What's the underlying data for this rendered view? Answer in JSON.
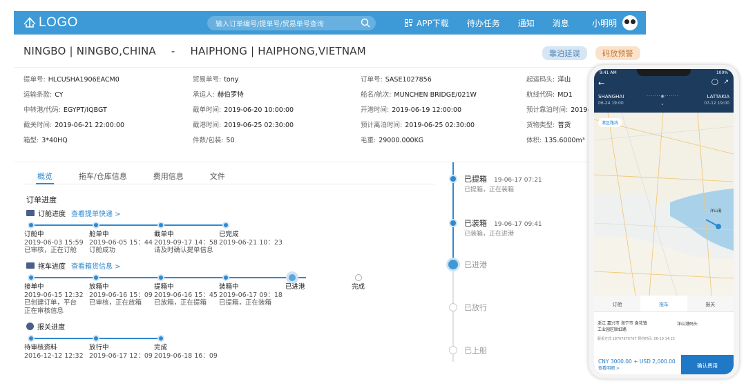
{
  "header": {
    "logo": "LOGO",
    "search_placeholder": "输入订单编号/提单号/贸易单号查询",
    "nav": [
      "APP下载",
      "待办任务",
      "通知",
      "消息"
    ],
    "user": "小明明"
  },
  "route": {
    "origin": "NINGBO | NINGBO,CHINA",
    "separator": "-",
    "destination": "HAIPHONG | HAIPHONG,VIETNAM",
    "badges": [
      "靠泊延误",
      "码放预警"
    ]
  },
  "info": {
    "c1": [
      [
        "提单号:",
        "HLCUSHA1906EACM0"
      ],
      [
        "运输条款:",
        "CY"
      ],
      [
        "中转港/代码:",
        "EGYPT/IQBGT"
      ],
      [
        "截关时间:",
        "2019-06-21 22:00:00"
      ],
      [
        "箱型:",
        "3*40HQ"
      ]
    ],
    "c2": [
      [
        "贸易单号:",
        "tony"
      ],
      [
        "承运人:",
        "赫伯罗特"
      ],
      [
        "截单时间:",
        "2019-06-20 10:00:00"
      ],
      [
        "截港时间:",
        "2019-06-25 02:30:00"
      ],
      [
        "件数/包装:",
        "50"
      ]
    ],
    "c3": [
      [
        "订单号:",
        "SASE1027856"
      ],
      [
        "船名/航次:",
        "MUNCHEN BRIDGE/021W"
      ],
      [
        "开港时间:",
        "2019-06-19 12:00:00"
      ],
      [
        "预计离泊时间:",
        "2019-06-25 02:30:00"
      ],
      [
        "毛重:",
        "29000.000KG"
      ]
    ],
    "c4": [
      [
        "起运码头:",
        "洋山"
      ],
      [
        "航线代码:",
        "MD1"
      ],
      [
        "预计靠泊时间:",
        "2019-"
      ],
      [
        "货物类型:",
        "普货"
      ],
      [
        "体积:",
        "135.6000m³"
      ]
    ]
  },
  "tabs": [
    "概览",
    "拖车/仓库信息",
    "费用信息",
    "文件"
  ],
  "progress": {
    "title": "订单进度",
    "booking": {
      "label": "订舱进度",
      "link": "查看提单快递 >",
      "steps": [
        {
          "t": "订舱中",
          "d": "2019-06-03 15:59",
          "s": "已审核，正在订舱",
          "s2": ""
        },
        {
          "t": "舱单中",
          "d": "2019-06-05 15：44",
          "s": "订舱成功",
          "s2": ""
        },
        {
          "t": "截单中",
          "d": "2019-09-17 14：58",
          "s": "请及时确认提单信息",
          "s2": ""
        },
        {
          "t": "已完成",
          "d": "2019-06-21 10：23",
          "s": "",
          "s2": ""
        }
      ]
    },
    "truck": {
      "label": "拖车进度",
      "link": "查看箱货信息 >",
      "steps": [
        {
          "t": "接单中",
          "d": "2019-06-15 12:32",
          "s": "已创建订单，平台",
          "s2": "正在审核信息"
        },
        {
          "t": "放箱中",
          "d": "2019-06-16 15：09",
          "s": "已审核，正在放箱",
          "s2": ""
        },
        {
          "t": "提箱中",
          "d": "2019-06-16 15：45",
          "s": "已放箱，正在提箱",
          "s2": ""
        },
        {
          "t": "装箱中",
          "d": "2019-06-17 09：18",
          "s": "已提箱，正在装箱",
          "s2": ""
        },
        {
          "t": "已进港",
          "d": "",
          "s": "",
          "s2": ""
        },
        {
          "t": "完成",
          "d": "",
          "s": "",
          "s2": ""
        }
      ]
    },
    "customs": {
      "label": "报关进度",
      "steps": [
        {
          "t": "待审核资料",
          "d": "2016-12-12 12:32",
          "s": "",
          "s2": ""
        },
        {
          "t": "放行中",
          "d": "2019-06-17 12：09",
          "s": "",
          "s2": ""
        },
        {
          "t": "完成",
          "d": "2019-06-18 16：09",
          "s": "",
          "s2": ""
        }
      ]
    }
  },
  "timeline": [
    {
      "t": "已提箱",
      "time": "19-06-17 07:21",
      "s": "已提箱，正在装箱"
    },
    {
      "t": "已装箱",
      "time": "19-06-17 09:41",
      "s": "已装箱，正在进港"
    },
    {
      "t": "已进港",
      "time": "",
      "s": ""
    },
    {
      "t": "已放行",
      "time": "",
      "s": ""
    },
    {
      "t": "已上船",
      "time": "",
      "s": ""
    }
  ],
  "phone": {
    "status_time": "9:41 AM",
    "battery": "100%",
    "from_city": "SHANGHAI",
    "from_date": "06-24 19:00",
    "to_city": "LATTAKIA",
    "to_date": "07-12 19:00",
    "map_label": "港区路线",
    "port_label": "洋山港",
    "tabs": [
      "订舱",
      "拖车",
      "报关"
    ],
    "card_line1": "浙江 嘉兴市 海宁市 袁花镇",
    "card_line2": "工业园区联虹路",
    "card_dest": "洋山港码头",
    "card_meta": "联系方式 18767876767 预约时间: 06-19 14:25",
    "price": "CNY 3000.00 + USD 2,000.00",
    "price_sub": "查看明细 >",
    "confirm": "确认费用"
  }
}
